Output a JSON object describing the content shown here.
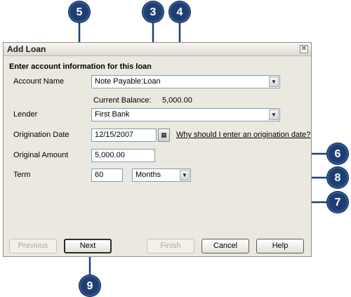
{
  "dialog": {
    "title": "Add Loan",
    "close_symbol": "✕",
    "heading": "Enter account information for this loan"
  },
  "form": {
    "account_name_label": "Account Name",
    "account_name_value": "Note Payable:Loan",
    "current_balance_label": "Current Balance:",
    "current_balance_value": "5,000.00",
    "lender_label": "Lender",
    "lender_value": "First Bank",
    "origination_date_label": "Origination Date",
    "origination_date_value": "12/15/2007",
    "origination_date_help": "Why should I enter an origination date?",
    "original_amount_label": "Original Amount",
    "original_amount_value": "5,000.00",
    "term_label": "Term",
    "term_value": "60",
    "term_unit_value": "Months"
  },
  "buttons": {
    "previous": "Previous",
    "next": "Next",
    "finish": "Finish",
    "cancel": "Cancel",
    "help": "Help"
  },
  "callouts": [
    "3",
    "4",
    "5",
    "6",
    "7",
    "8",
    "9"
  ],
  "colors": {
    "callout_fill": "#1f3f73",
    "callout_line": "#1f3f73",
    "dialog_bg": "#ebe9df"
  },
  "icons": {
    "dropdown": "chevron-down-icon",
    "calendar": "calendar-icon",
    "close": "close-icon"
  }
}
